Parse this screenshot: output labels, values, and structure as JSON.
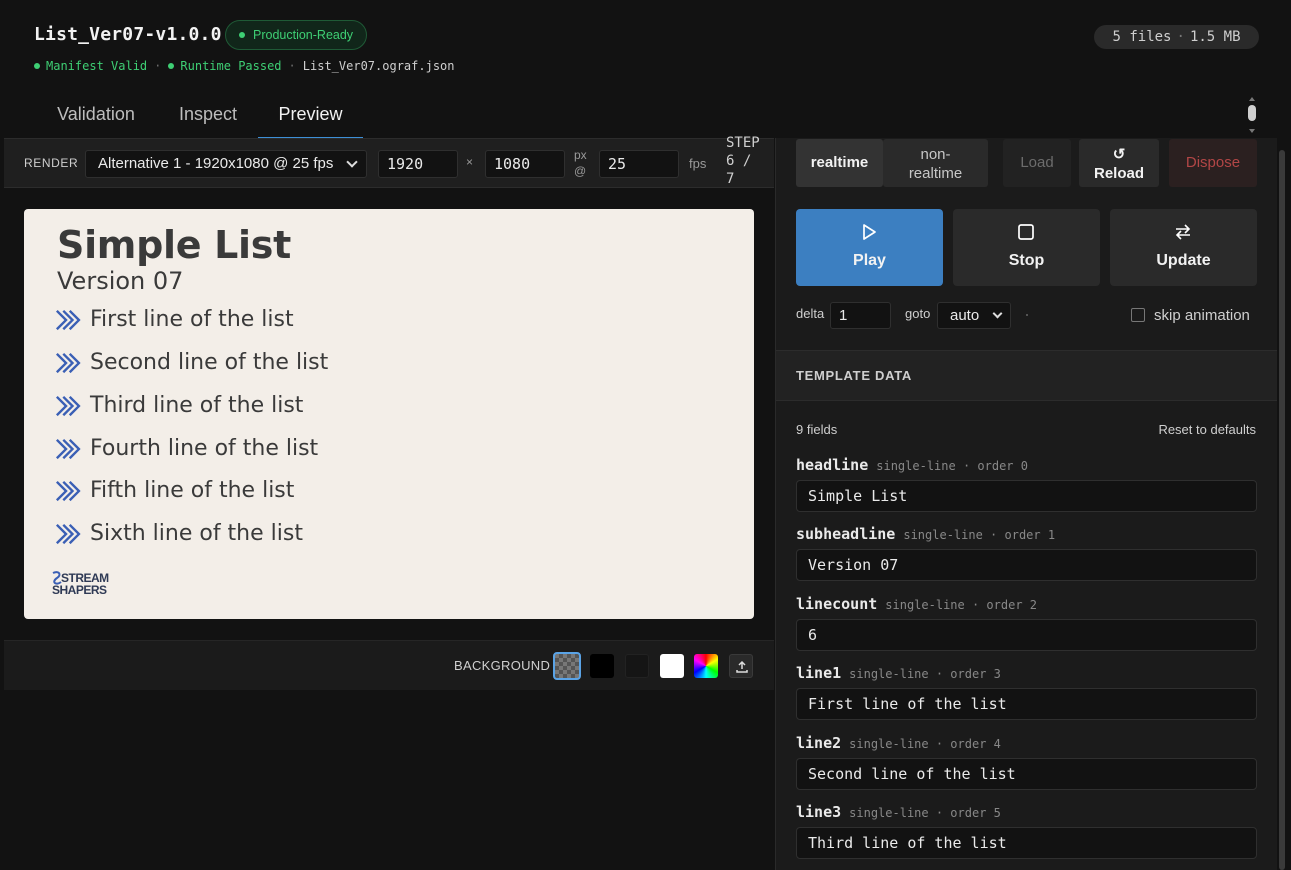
{
  "header": {
    "title": "List_Ver07-v1.0.0",
    "badge": "Production-Ready",
    "status_manifest": "Manifest Valid",
    "status_runtime": "Runtime Passed",
    "sep": "·",
    "manifest_file": "List_Ver07.ograf.json",
    "files_count": "5 files",
    "files_size": "1.5 MB"
  },
  "tabs": [
    {
      "label": "Validation"
    },
    {
      "label": "Inspect"
    },
    {
      "label": "Preview",
      "active": true
    }
  ],
  "render": {
    "label": "RENDER",
    "alternative": "Alternative 1 - 1920x1080 @ 25 fps",
    "width": "1920",
    "times": "×",
    "height": "1080",
    "px_at": "px @",
    "fps_value": "25",
    "fps_label": "fps",
    "step_label": "STEP",
    "step_value": "6 / 7"
  },
  "preview": {
    "headline": "Simple List",
    "subheadline": "Version 07",
    "lines": [
      "First line of the list",
      "Second line of the list",
      "Third line of the list",
      "Fourth line of the list",
      "Fifth line of the list",
      "Sixth line of the list"
    ],
    "logo_line1": "STREAM",
    "logo_line2": "SHAPERS",
    "bullet_color": "#3a5fb5",
    "background_color": "#f3eee8"
  },
  "background": {
    "label": "BACKGROUND",
    "options": [
      "checker",
      "black",
      "dark",
      "white",
      "custom-color",
      "upload"
    ],
    "selected": "checker"
  },
  "controls": {
    "realtime": "realtime",
    "non_realtime": "non-realtime",
    "load": "Load",
    "reload": "Reload",
    "dispose": "Dispose",
    "play": "Play",
    "stop": "Stop",
    "update": "Update",
    "delta_label": "delta",
    "delta_value": "1",
    "goto_label": "goto",
    "goto_value": "auto",
    "skip_animation": "skip animation",
    "accent": "#3c7fc1"
  },
  "template_data": {
    "title": "TEMPLATE DATA",
    "field_count": "9 fields",
    "reset": "Reset to defaults",
    "fields": [
      {
        "name": "headline",
        "meta": "single-line · order 0",
        "value": "Simple List"
      },
      {
        "name": "subheadline",
        "meta": "single-line · order 1",
        "value": "Version 07"
      },
      {
        "name": "linecount",
        "meta": "single-line · order 2",
        "value": "6"
      },
      {
        "name": "line1",
        "meta": "single-line · order 3",
        "value": "First line of the list"
      },
      {
        "name": "line2",
        "meta": "single-line · order 4",
        "value": "Second line of the list"
      },
      {
        "name": "line3",
        "meta": "single-line · order 5",
        "value": "Third line of the list"
      }
    ]
  }
}
